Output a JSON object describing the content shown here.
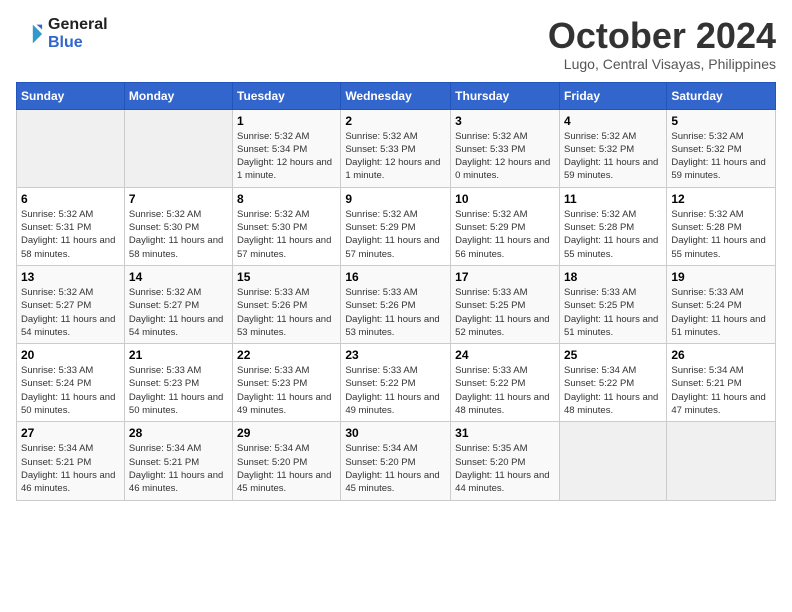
{
  "logo": {
    "line1": "General",
    "line2": "Blue"
  },
  "title": "October 2024",
  "location": "Lugo, Central Visayas, Philippines",
  "days_of_week": [
    "Sunday",
    "Monday",
    "Tuesday",
    "Wednesday",
    "Thursday",
    "Friday",
    "Saturday"
  ],
  "weeks": [
    [
      {
        "day": "",
        "info": ""
      },
      {
        "day": "",
        "info": ""
      },
      {
        "day": "1",
        "info": "Sunrise: 5:32 AM\nSunset: 5:34 PM\nDaylight: 12 hours and 1 minute."
      },
      {
        "day": "2",
        "info": "Sunrise: 5:32 AM\nSunset: 5:33 PM\nDaylight: 12 hours and 1 minute."
      },
      {
        "day": "3",
        "info": "Sunrise: 5:32 AM\nSunset: 5:33 PM\nDaylight: 12 hours and 0 minutes."
      },
      {
        "day": "4",
        "info": "Sunrise: 5:32 AM\nSunset: 5:32 PM\nDaylight: 11 hours and 59 minutes."
      },
      {
        "day": "5",
        "info": "Sunrise: 5:32 AM\nSunset: 5:32 PM\nDaylight: 11 hours and 59 minutes."
      }
    ],
    [
      {
        "day": "6",
        "info": "Sunrise: 5:32 AM\nSunset: 5:31 PM\nDaylight: 11 hours and 58 minutes."
      },
      {
        "day": "7",
        "info": "Sunrise: 5:32 AM\nSunset: 5:30 PM\nDaylight: 11 hours and 58 minutes."
      },
      {
        "day": "8",
        "info": "Sunrise: 5:32 AM\nSunset: 5:30 PM\nDaylight: 11 hours and 57 minutes."
      },
      {
        "day": "9",
        "info": "Sunrise: 5:32 AM\nSunset: 5:29 PM\nDaylight: 11 hours and 57 minutes."
      },
      {
        "day": "10",
        "info": "Sunrise: 5:32 AM\nSunset: 5:29 PM\nDaylight: 11 hours and 56 minutes."
      },
      {
        "day": "11",
        "info": "Sunrise: 5:32 AM\nSunset: 5:28 PM\nDaylight: 11 hours and 55 minutes."
      },
      {
        "day": "12",
        "info": "Sunrise: 5:32 AM\nSunset: 5:28 PM\nDaylight: 11 hours and 55 minutes."
      }
    ],
    [
      {
        "day": "13",
        "info": "Sunrise: 5:32 AM\nSunset: 5:27 PM\nDaylight: 11 hours and 54 minutes."
      },
      {
        "day": "14",
        "info": "Sunrise: 5:32 AM\nSunset: 5:27 PM\nDaylight: 11 hours and 54 minutes."
      },
      {
        "day": "15",
        "info": "Sunrise: 5:33 AM\nSunset: 5:26 PM\nDaylight: 11 hours and 53 minutes."
      },
      {
        "day": "16",
        "info": "Sunrise: 5:33 AM\nSunset: 5:26 PM\nDaylight: 11 hours and 53 minutes."
      },
      {
        "day": "17",
        "info": "Sunrise: 5:33 AM\nSunset: 5:25 PM\nDaylight: 11 hours and 52 minutes."
      },
      {
        "day": "18",
        "info": "Sunrise: 5:33 AM\nSunset: 5:25 PM\nDaylight: 11 hours and 51 minutes."
      },
      {
        "day": "19",
        "info": "Sunrise: 5:33 AM\nSunset: 5:24 PM\nDaylight: 11 hours and 51 minutes."
      }
    ],
    [
      {
        "day": "20",
        "info": "Sunrise: 5:33 AM\nSunset: 5:24 PM\nDaylight: 11 hours and 50 minutes."
      },
      {
        "day": "21",
        "info": "Sunrise: 5:33 AM\nSunset: 5:23 PM\nDaylight: 11 hours and 50 minutes."
      },
      {
        "day": "22",
        "info": "Sunrise: 5:33 AM\nSunset: 5:23 PM\nDaylight: 11 hours and 49 minutes."
      },
      {
        "day": "23",
        "info": "Sunrise: 5:33 AM\nSunset: 5:22 PM\nDaylight: 11 hours and 49 minutes."
      },
      {
        "day": "24",
        "info": "Sunrise: 5:33 AM\nSunset: 5:22 PM\nDaylight: 11 hours and 48 minutes."
      },
      {
        "day": "25",
        "info": "Sunrise: 5:34 AM\nSunset: 5:22 PM\nDaylight: 11 hours and 48 minutes."
      },
      {
        "day": "26",
        "info": "Sunrise: 5:34 AM\nSunset: 5:21 PM\nDaylight: 11 hours and 47 minutes."
      }
    ],
    [
      {
        "day": "27",
        "info": "Sunrise: 5:34 AM\nSunset: 5:21 PM\nDaylight: 11 hours and 46 minutes."
      },
      {
        "day": "28",
        "info": "Sunrise: 5:34 AM\nSunset: 5:21 PM\nDaylight: 11 hours and 46 minutes."
      },
      {
        "day": "29",
        "info": "Sunrise: 5:34 AM\nSunset: 5:20 PM\nDaylight: 11 hours and 45 minutes."
      },
      {
        "day": "30",
        "info": "Sunrise: 5:34 AM\nSunset: 5:20 PM\nDaylight: 11 hours and 45 minutes."
      },
      {
        "day": "31",
        "info": "Sunrise: 5:35 AM\nSunset: 5:20 PM\nDaylight: 11 hours and 44 minutes."
      },
      {
        "day": "",
        "info": ""
      },
      {
        "day": "",
        "info": ""
      }
    ]
  ]
}
